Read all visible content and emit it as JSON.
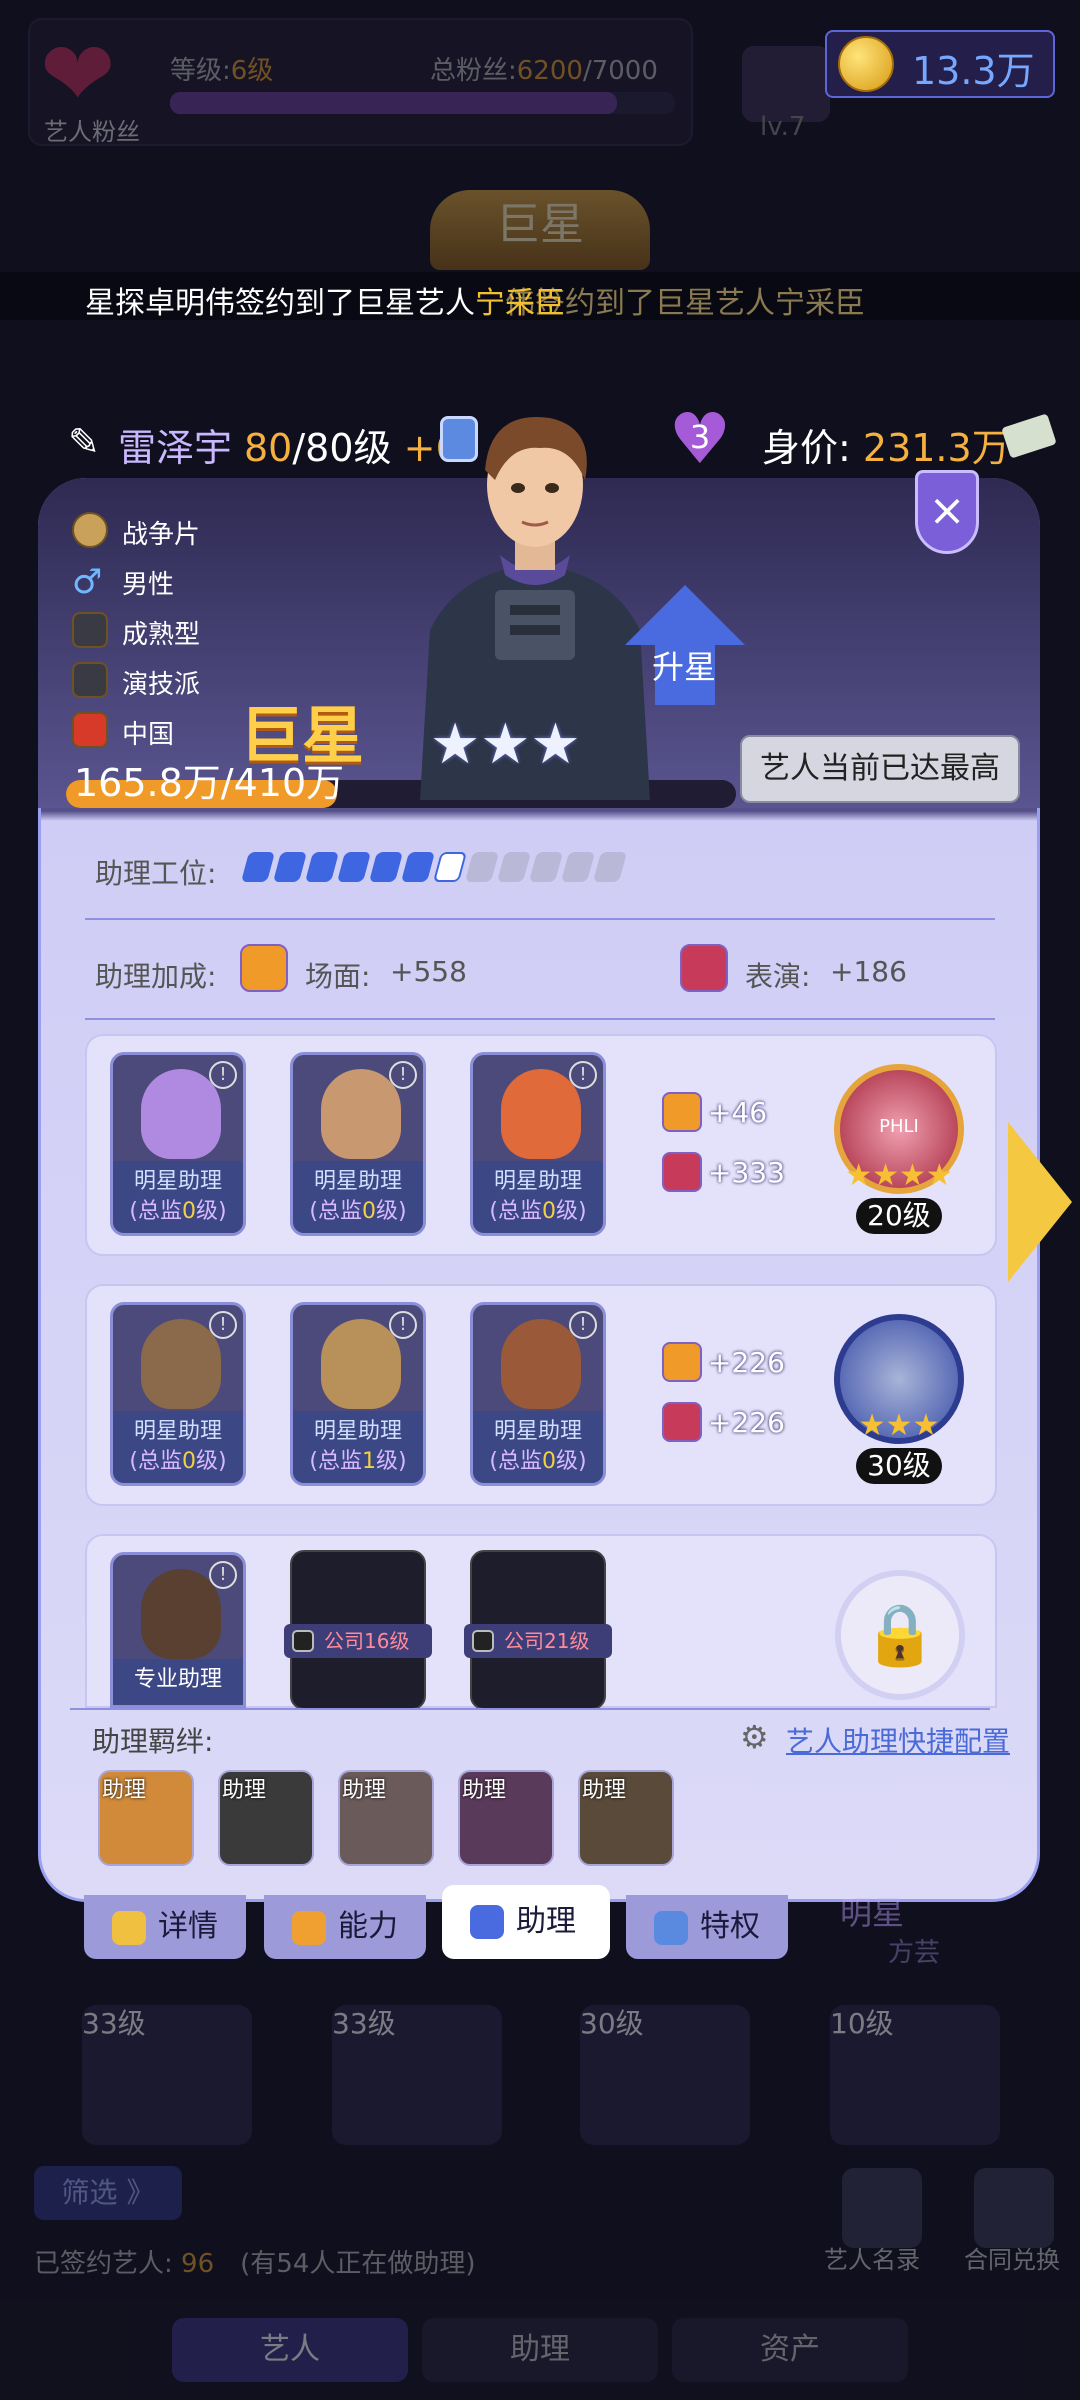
{
  "top": {
    "fan_label": "艺人粉丝",
    "level_label": "等级:",
    "level_value": "6级",
    "fans_label": "总粉丝:",
    "fans_value": "6200",
    "fans_max": "/7000",
    "fans_progress": 0.886,
    "coins": "13.3万",
    "studio_level": "lv.7"
  },
  "banner": {
    "rank_title": "巨星",
    "news_prefix": "星探卓明伟签约到了巨星艺人",
    "news_highlight": "宁采臣",
    "news_ghost": "伟签约到了巨星艺人宁采臣"
  },
  "artist": {
    "name": "雷泽宇",
    "level": "80",
    "level_max": "/80级",
    "level_bonus": "+6",
    "hearts": "3",
    "worth_label": "身价:",
    "worth_value": "231.3万"
  },
  "card": {
    "tags": [
      "战争片",
      "男性",
      "成熟型",
      "演技派",
      "中国"
    ],
    "rank": "巨星",
    "progress_text": "165.8万/410万",
    "progress": 0.404,
    "stars": 3,
    "upstar_label": "升星",
    "max_label": "艺人当前已达最高",
    "close_icon": "×"
  },
  "assistant": {
    "slots_label": "助理工位:",
    "slots_total": 12,
    "slots_filled": 7,
    "bonus_label": "助理加成:",
    "bonus": [
      {
        "label": "场面:",
        "value": "+558"
      },
      {
        "label": "表演:",
        "value": "+186"
      }
    ],
    "teams": [
      {
        "members": [
          {
            "title": "明星助理",
            "sub_prefix": "(总监",
            "sub_level": "0",
            "sub_suffix": "级)"
          },
          {
            "title": "明星助理",
            "sub_prefix": "(总监",
            "sub_level": "0",
            "sub_suffix": "级)"
          },
          {
            "title": "明星助理",
            "sub_prefix": "(总监",
            "sub_level": "0",
            "sub_suffix": "级)"
          }
        ],
        "stat1": "+46",
        "stat2": "+333",
        "trophy_label": "PHLI",
        "trophy_stars": "★★★★",
        "trophy_level": "20级"
      },
      {
        "members": [
          {
            "title": "明星助理",
            "sub_prefix": "(总监",
            "sub_level": "0",
            "sub_suffix": "级)"
          },
          {
            "title": "明星助理",
            "sub_prefix": "(总监",
            "sub_level": "1",
            "sub_suffix": "级)"
          },
          {
            "title": "明星助理",
            "sub_prefix": "(总监",
            "sub_level": "0",
            "sub_suffix": "级)"
          }
        ],
        "stat1": "+226",
        "stat2": "+226",
        "trophy_stars": "★★★",
        "trophy_level": "30级"
      }
    ],
    "team3": {
      "member_title": "专业助理",
      "locked1": "公司16级",
      "locked2": "公司21级"
    },
    "bond_label": "助理羁绊:",
    "quick_config": "艺人助理快捷配置",
    "bond_tag": "助理"
  },
  "tabs": [
    "详情",
    "能力",
    "助理",
    "特权"
  ],
  "tab_active": 2,
  "background": {
    "levels": [
      "33级",
      "33级",
      "30级",
      "10级"
    ],
    "ghost_name": "明星",
    "ghost_sub": "方芸",
    "filter": "筛选 》",
    "signed_label": "已签约艺人:",
    "signed_count": "96",
    "signed_note": "(有54人正在做助理)",
    "right_btn1": "艺人名录",
    "right_btn2": "合同兑换",
    "nav": [
      "艺人",
      "助理",
      "资产"
    ]
  },
  "colors": {
    "accent_gold": "#f5b040",
    "accent_purple": "#9aa0f0",
    "link_blue": "#4a6ad8"
  }
}
